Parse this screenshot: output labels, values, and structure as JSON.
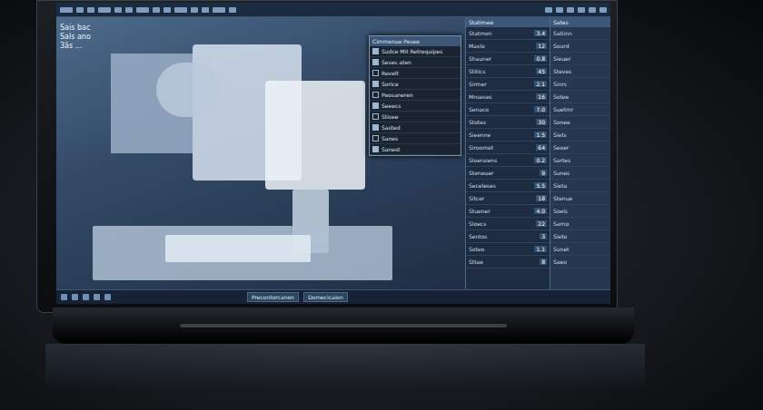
{
  "corner_labels": [
    "Sais bac",
    "Sals ano",
    "3ās ..."
  ],
  "overlay": {
    "title": "Cimmenae Pesee",
    "rows": [
      {
        "label": "Sudce Mit Retrequipes",
        "checked": true
      },
      {
        "label": "Seses aten",
        "checked": true
      },
      {
        "label": "Revelt",
        "checked": false
      },
      {
        "label": "Sorice",
        "checked": true
      },
      {
        "label": "Peosaneren",
        "checked": false
      },
      {
        "label": "Seeecs",
        "checked": true
      },
      {
        "label": "Stisee",
        "checked": false
      },
      {
        "label": "Sasted",
        "checked": true
      },
      {
        "label": "Sanes",
        "checked": false
      },
      {
        "label": "Sanest",
        "checked": true
      }
    ]
  },
  "panel": {
    "title": "Statimee",
    "rows": [
      {
        "label": "Statmon",
        "value": "3.4"
      },
      {
        "label": "Maxlo",
        "value": "12"
      },
      {
        "label": "Shauner",
        "value": "0.8"
      },
      {
        "label": "Stitics",
        "value": "45"
      },
      {
        "label": "Sirmer",
        "value": "2.1"
      },
      {
        "label": "Mnseses",
        "value": "16"
      },
      {
        "label": "Senaco",
        "value": "7.0"
      },
      {
        "label": "Stotes",
        "value": "30"
      },
      {
        "label": "Sieenne",
        "value": "1.5"
      },
      {
        "label": "Siroomet",
        "value": "64"
      },
      {
        "label": "Sloeraiens",
        "value": "0.2"
      },
      {
        "label": "Steneuer",
        "value": "9"
      },
      {
        "label": "Seceleses",
        "value": "5.5"
      },
      {
        "label": "Sitcer",
        "value": "18"
      },
      {
        "label": "Stuener",
        "value": "4.0"
      },
      {
        "label": "Sloecs",
        "value": "22"
      },
      {
        "label": "Sentos",
        "value": "3"
      },
      {
        "label": "Soteo",
        "value": "1.1"
      },
      {
        "label": "Sttae",
        "value": "8"
      }
    ]
  },
  "side": {
    "title": "Sates",
    "rows": [
      "Satiinn",
      "Sourd",
      "Sieuer",
      "Steves",
      "Sinrs",
      "Sotee",
      "Suetmr",
      "Sonee",
      "Siets",
      "Seoer",
      "Sartes",
      "Sunes",
      "Sieta",
      "Stenue",
      "Soels",
      "Sarno",
      "Sieto",
      "Sunet",
      "Saeo"
    ]
  },
  "taskbar": {
    "tags": [
      "Precontorcanon",
      "Domecicaion"
    ]
  }
}
